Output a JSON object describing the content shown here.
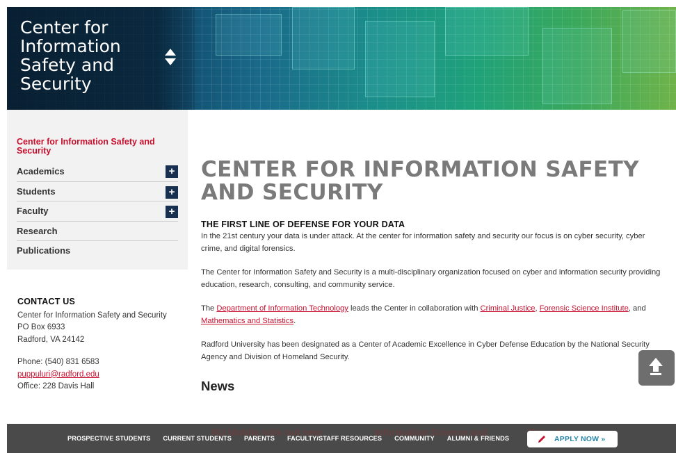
{
  "header": {
    "site_title": "Center for Information Safety and Security"
  },
  "sidebar": {
    "heading": "Center for Information Safety and Security",
    "items": [
      {
        "label": "Academics",
        "expand": "+"
      },
      {
        "label": "Students",
        "expand": "+"
      },
      {
        "label": "Faculty",
        "expand": "+"
      },
      {
        "label": "Research"
      },
      {
        "label": "Publications"
      }
    ]
  },
  "contact": {
    "heading": "CONTACT US",
    "name": "Center for Information Safety and Security",
    "po_box": "PO Box 6933",
    "city": "Radford, VA 24142",
    "phone": "Phone: (540) 831 6583",
    "email": "puppuluri@radford.edu",
    "office": "Office: 228 Davis Hall"
  },
  "main": {
    "title": "CENTER FOR INFORMATION SAFETY AND SECURITY",
    "subtitle": "THE FIRST LINE OF DEFENSE FOR YOUR DATA",
    "para1": "In the 21st century your data is under attack. At the center for information safety and security our focus is on cyber security, cyber crime, and digital forensics.",
    "para2": "The Center for Information Safety and Security is a multi-disciplinary organization focused on cyber and information security providing education, research, consulting, and community service.",
    "para3": {
      "t1": "The ",
      "link_it": "Department of Information Technology",
      "t2": " leads the Center in collaboration with ",
      "link_cj": "Criminal Justice",
      "t3": ", ",
      "link_fsi": "Forensic Science Institute",
      "t4": ", and ",
      "link_ms": "Mathematics and Statistics",
      "t5": "."
    },
    "para4": "Radford University has been designated as a Center of Academic Excellence in Cyber Defense Education by the National Security Agency and Division of Homeland Security.",
    "news_heading": "News"
  },
  "news_ghost": {
    "item1": "RU Mobile rolls out new",
    "item2": "Information Science and",
    "item3": "RU ... the"
  },
  "footer": {
    "links": [
      "PROSPECTIVE STUDENTS",
      "CURRENT STUDENTS",
      "PARENTS",
      "FACULTY/STAFF RESOURCES",
      "COMMUNITY",
      "ALUMNI & FRIENDS"
    ],
    "apply_label": "APPLY NOW »"
  },
  "colors": {
    "accent_red": "#c8102e",
    "nav_blue": "#17304f",
    "footer_gray": "#4a4a4a",
    "apply_teal": "#2a86a8"
  },
  "icons": {
    "sort": "sort-toggle-icon",
    "expand": "plus-icon",
    "back_to_top": "arrow-up-icon",
    "apply": "pencil-icon"
  }
}
